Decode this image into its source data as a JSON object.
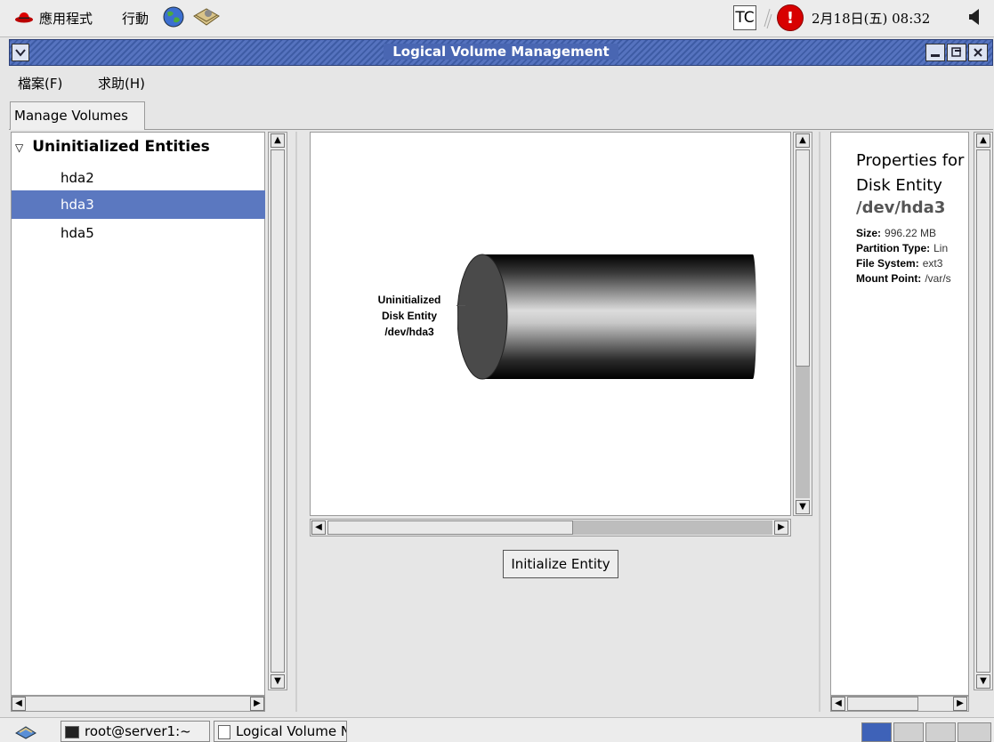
{
  "top_panel": {
    "applications_label": "應用程式",
    "actions_label": "行動",
    "input_method": "TC",
    "clock": "2月18日(五) 08:32",
    "icons": [
      "redhat-logo-icon",
      "globe-icon",
      "mail-icon",
      "alert-icon",
      "volume-icon"
    ]
  },
  "window": {
    "title": "Logical Volume Management",
    "menu": {
      "file": "檔案(F)",
      "help": "求助(H)"
    },
    "tab": "Manage Volumes"
  },
  "tree": {
    "header": "Uninitialized Entities",
    "items": [
      {
        "label": "hda2",
        "selected": false
      },
      {
        "label": "hda3",
        "selected": true
      },
      {
        "label": "hda5",
        "selected": false
      }
    ]
  },
  "canvas": {
    "disk_label_line1": "Uninitialized",
    "disk_label_line2": "Disk Entity",
    "disk_label_line3": "/dev/hda3",
    "initialize_button": "Initialize Entity"
  },
  "properties": {
    "title_line1": "Properties for",
    "title_line2": "Disk Entity",
    "device": "/dev/hda3",
    "rows": [
      {
        "key": "Size:",
        "value": "996.22 MB"
      },
      {
        "key": "Partition Type:",
        "value": "Lin"
      },
      {
        "key": "File System:",
        "value": "ext3"
      },
      {
        "key": "Mount Point:",
        "value": "/var/s"
      }
    ]
  },
  "taskbar": {
    "tasks": [
      "root@server1:~",
      "Logical Volume N"
    ]
  },
  "colors": {
    "selection": "#5b78c0",
    "titlebar": "#4966b2",
    "active_workspace": "#3e62b8"
  }
}
